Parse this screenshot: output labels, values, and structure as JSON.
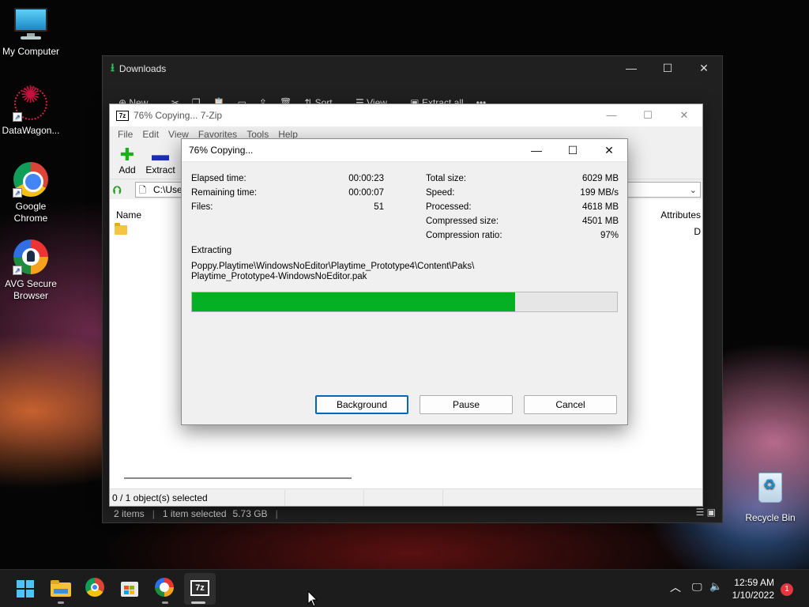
{
  "desktop": {
    "icons": [
      {
        "label": "My Computer"
      },
      {
        "label": "DataWagon..."
      },
      {
        "label": "Google Chrome"
      },
      {
        "label": "AVG Secure Browser"
      },
      {
        "label": "Recycle Bin"
      }
    ]
  },
  "explorer": {
    "title": "Downloads",
    "toolbar": {
      "new": "New",
      "sort": "Sort",
      "view": "View",
      "extract_all": "Extract all",
      "more": "•••"
    },
    "status": {
      "items": "2 items",
      "selected": "1 item selected",
      "size": "5.73 GB"
    }
  },
  "zip_window": {
    "title": "76% Copying... 7-Zip",
    "logo": "7z",
    "menu": [
      "File",
      "Edit",
      "View",
      "Favorites",
      "Tools",
      "Help"
    ],
    "toolbar": {
      "add": "Add",
      "extract": "Extract"
    },
    "address": "C:\\Use",
    "columns": {
      "name": "Name",
      "attributes": "Attributes"
    },
    "row_attr": "D",
    "status": "0 / 1 object(s) selected"
  },
  "dialog": {
    "title": "76% Copying...",
    "left": [
      {
        "label": "Elapsed time:",
        "value": "00:00:23"
      },
      {
        "label": "Remaining time:",
        "value": "00:00:07"
      },
      {
        "label": "Files:",
        "value": "51"
      }
    ],
    "right": [
      {
        "label": "Total size:",
        "value": "6029 MB"
      },
      {
        "label": "Speed:",
        "value": "199 MB/s"
      },
      {
        "label": "Processed:",
        "value": "4618 MB"
      },
      {
        "label": "Compressed size:",
        "value": "4501 MB"
      },
      {
        "label": "Compression ratio:",
        "value": "97%"
      }
    ],
    "operation": "Extracting",
    "path_line1": "Poppy.Playtime\\WindowsNoEditor\\Playtime_Prototype4\\Content\\Paks\\",
    "path_line2": "Playtime_Prototype4-WindowsNoEditor.pak",
    "progress_fraction": 0.76,
    "buttons": {
      "background": "Background",
      "pause": "Pause",
      "cancel": "Cancel"
    }
  },
  "taskbar": {
    "clock_time": "12:59 AM",
    "clock_date": "1/10/2022",
    "notification_count": "1"
  },
  "colors": {
    "progress_green": "#06b025",
    "accent": "#0067c0",
    "windows_blue": "#4cc2ff"
  }
}
